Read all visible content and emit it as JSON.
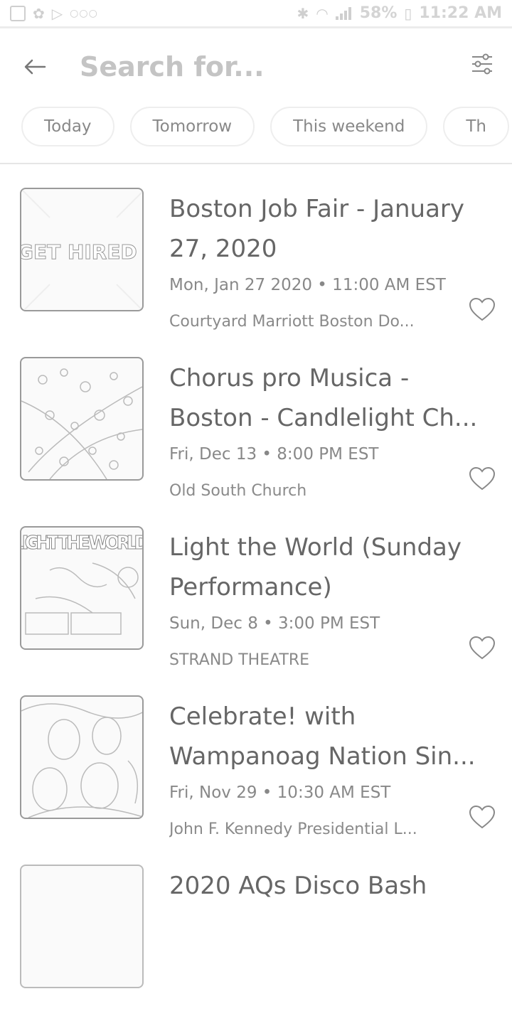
{
  "status_bar": {
    "battery": "58%",
    "time": "11:22 AM"
  },
  "search": {
    "placeholder": "Search for..."
  },
  "chips": [
    "Today",
    "Tomorrow",
    "This weekend",
    "Th"
  ],
  "events": [
    {
      "title": "Boston Job Fair - January 27, 2020",
      "date": "Mon, Jan 27 2020 • 11:00 AM EST",
      "venue": "Courtyard Marriott Boston Do...",
      "thumb_text": "GET HIRED"
    },
    {
      "title": "Chorus pro Musica - Boston - Candlelight Ch...",
      "date": "Fri, Dec 13 • 8:00 PM EST",
      "venue": "Old South Church"
    },
    {
      "title": "Light the World (Sunday Performance)",
      "date": "Sun, Dec 8 • 3:00 PM EST",
      "venue": "STRAND THEATRE",
      "thumb_text": "LIGHT THE WORLD"
    },
    {
      "title": "Celebrate! with Wampanoag Nation Sin...",
      "date": "Fri, Nov 29 • 10:30 AM EST",
      "venue": "John F. Kennedy Presidential L..."
    },
    {
      "title": "2020 AQs Disco Bash",
      "date": "",
      "venue": ""
    }
  ]
}
